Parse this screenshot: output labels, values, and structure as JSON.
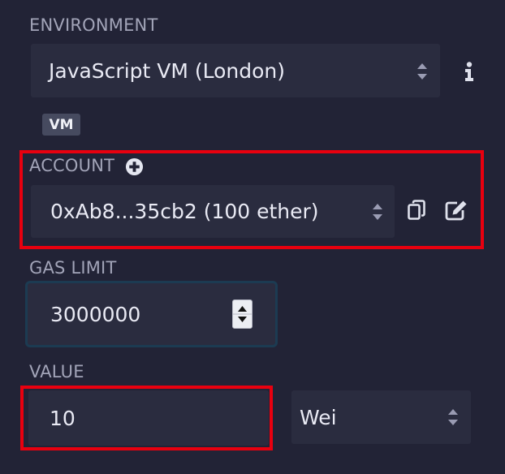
{
  "environment": {
    "label": "ENVIRONMENT",
    "selected": "JavaScript VM (London)",
    "badge": "VM",
    "info_icon": "info-icon"
  },
  "account": {
    "label": "ACCOUNT",
    "add_icon": "plus-circle-icon",
    "selected": "0xAb8...35cb2 (100 ether)",
    "copy_icon": "copy-icon",
    "edit_icon": "edit-icon"
  },
  "gas_limit": {
    "label": "GAS LIMIT",
    "value": "3000000"
  },
  "value": {
    "label": "VALUE",
    "amount": "10",
    "unit": "Wei"
  },
  "colors": {
    "background": "#222336",
    "field": "#2a2c3f",
    "highlight": "#e8000f",
    "focus_border": "#1c3b52"
  }
}
